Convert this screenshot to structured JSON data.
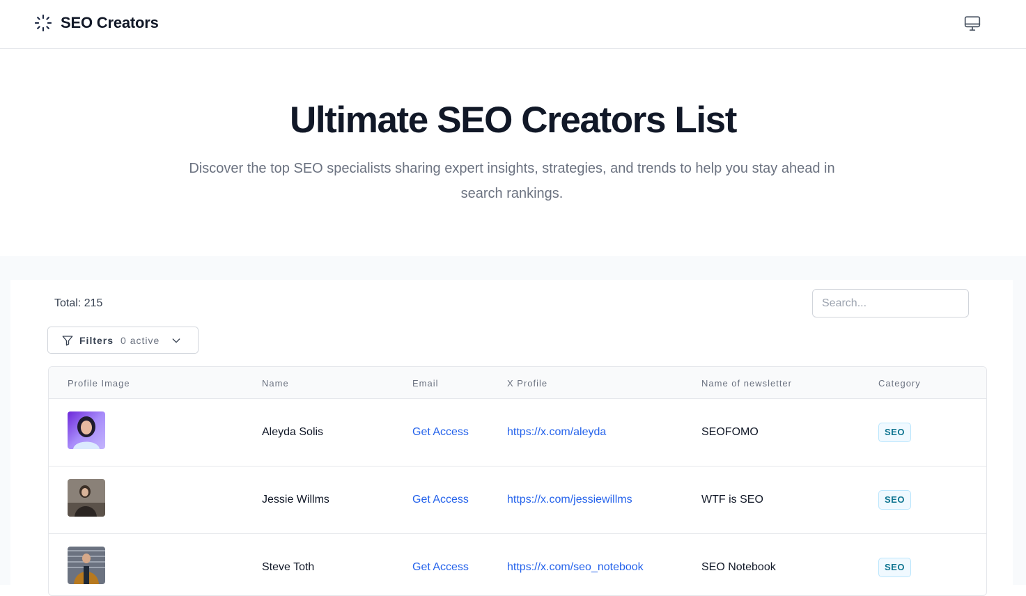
{
  "header": {
    "brand_name": "SEO Creators",
    "brand_icon": "spinner-dots-icon",
    "theme_icon": "monitor-icon"
  },
  "hero": {
    "title": "Ultimate SEO Creators List",
    "subtitle": "Discover the top SEO specialists sharing expert insights, strategies, and trends to help you stay ahead in search rankings."
  },
  "toolbar": {
    "total_text": "Total: 215",
    "search_placeholder": "Search...",
    "filters_label": "Filters",
    "filters_active": "0 active"
  },
  "table": {
    "columns": [
      "Profile Image",
      "Name",
      "Email",
      "X Profile",
      "Name of newsletter",
      "Category"
    ],
    "rows": [
      {
        "name": "Aleyda Solis",
        "email": "Get Access",
        "x_profile": "https://x.com/aleyda",
        "newsletter": "SEOFOMO",
        "category": "SEO"
      },
      {
        "name": "Jessie Willms",
        "email": "Get Access",
        "x_profile": "https://x.com/jessiewillms",
        "newsletter": "WTF is SEO",
        "category": "SEO"
      },
      {
        "name": "Steve Toth",
        "email": "Get Access",
        "x_profile": "https://x.com/seo_notebook",
        "newsletter": "SEO Notebook",
        "category": "SEO"
      }
    ]
  },
  "colors": {
    "accent_link": "#2563eb",
    "badge_text": "#0e7490",
    "badge_bg": "#f0f9ff"
  }
}
